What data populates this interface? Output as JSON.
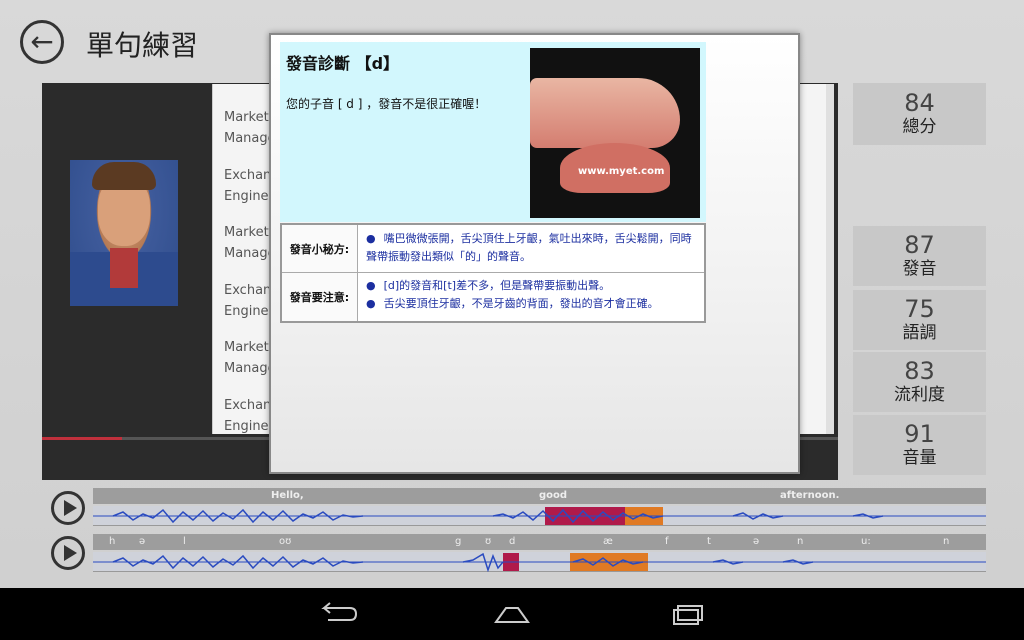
{
  "header": {
    "back_glyph": "←",
    "title": "單句練習"
  },
  "list_items": [
    "Marketi",
    "Manage",
    "Exchan",
    "Enginee",
    "Marketi",
    "Manage",
    "Exchan",
    "Enginee",
    "Marketi",
    "Manage",
    "Exchan",
    "Enginee"
  ],
  "video": {
    "progress_fraction": 0.1
  },
  "scores": {
    "total": {
      "value": "84",
      "label": "總分"
    },
    "items": [
      {
        "value": "87",
        "label": "發音"
      },
      {
        "value": "75",
        "label": "語調"
      },
      {
        "value": "83",
        "label": "流利度"
      },
      {
        "value": "91",
        "label": "音量"
      }
    ]
  },
  "diagnosis": {
    "title": "發音診斷 【d】",
    "message": "您的子音 [ d ] ，發音不是很正確喔！",
    "image_watermark": "www.myet.com",
    "tips_label": "發音小秘方:",
    "tips": [
      "嘴巴微微張開，舌尖頂住上牙齦，氣吐出來時，舌尖鬆開，同時聲帶振動發出類似「的」的聲音。"
    ],
    "notes_label": "發音要注意:",
    "notes": [
      "[d]的發音和[t]差不多，但是聲帶要振動出聲。",
      "舌尖要頂住牙齦，不是牙齒的背面，發出的音才會正確。"
    ]
  },
  "waveform_words": [
    "Hello,",
    "good",
    "afternoon."
  ],
  "waveform_phones": [
    "h",
    "ə",
    "l",
    "oʊ",
    "g",
    "ʊ",
    "d",
    "æ",
    "f",
    "t",
    "ə",
    "n",
    "u:",
    "n"
  ],
  "colors": {
    "accent_red": "#c0303c",
    "diag_bg": "#d2f7fd",
    "tip_text": "#1c2fa0",
    "wave_blue": "#2a4bc0",
    "seg_red": "#b01a4a",
    "seg_orange": "#e07a24"
  },
  "nav": {
    "back_icon": "back-arrow-icon",
    "home_icon": "home-icon",
    "recents_icon": "recents-icon"
  }
}
